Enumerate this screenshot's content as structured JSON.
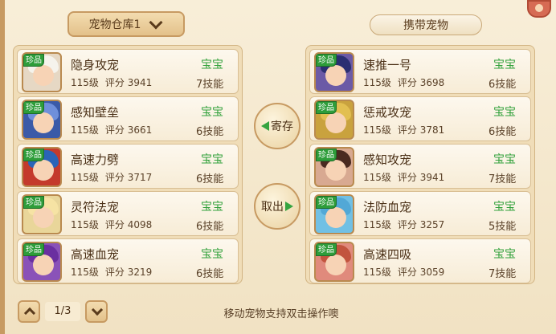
{
  "left_header": {
    "label": "宠物仓库1"
  },
  "right_header": {
    "label": "携带宠物"
  },
  "buttons": {
    "store": "寄存",
    "take": "取出"
  },
  "level_label": "级",
  "score_label": "评分",
  "skills_suffix": "技能",
  "storage_pets": [
    {
      "tag": "珍品",
      "name": "隐身攻宠",
      "level": "115",
      "score": "3941",
      "type": "宝宝",
      "skills": "7",
      "palette": {
        "bg": "#e6d8c4",
        "hair": "#f5f3ec"
      }
    },
    {
      "tag": "珍品",
      "name": "感知壁垒",
      "level": "115",
      "score": "3661",
      "type": "宝宝",
      "skills": "6",
      "palette": {
        "bg": "#3b5aa8",
        "hair": "#6f8fdb"
      }
    },
    {
      "tag": "珍品",
      "name": "高速力劈",
      "level": "115",
      "score": "3717",
      "type": "宝宝",
      "skills": "6",
      "palette": {
        "bg": "#c43a2c",
        "hair": "#2a64b8"
      }
    },
    {
      "tag": "珍品",
      "name": "灵符法宠",
      "level": "115",
      "score": "4098",
      "type": "宝宝",
      "skills": "6",
      "palette": {
        "bg": "#e9d69a",
        "hair": "#f6e3a4"
      }
    },
    {
      "tag": "珍品",
      "name": "高速血宠",
      "level": "115",
      "score": "3219",
      "type": "宝宝",
      "skills": "6",
      "palette": {
        "bg": "#8a52b8",
        "hair": "#6a2fa0"
      }
    }
  ],
  "carried_pets": [
    {
      "tag": "珍品",
      "name": "速推一号",
      "level": "115",
      "score": "3698",
      "type": "宝宝",
      "skills": "6",
      "palette": {
        "bg": "#6b5aa6",
        "hair": "#2b2f72"
      }
    },
    {
      "tag": "珍品",
      "name": "惩戒攻宠",
      "level": "115",
      "score": "3781",
      "type": "宝宝",
      "skills": "6",
      "palette": {
        "bg": "#c9a23e",
        "hair": "#e2bf51"
      }
    },
    {
      "tag": "珍品",
      "name": "感知攻宠",
      "level": "115",
      "score": "3941",
      "type": "宝宝",
      "skills": "7",
      "palette": {
        "bg": "#d8a991",
        "hair": "#4a2a20"
      }
    },
    {
      "tag": "珍品",
      "name": "法防血宠",
      "level": "115",
      "score": "3257",
      "type": "宝宝",
      "skills": "5",
      "palette": {
        "bg": "#71c0e4",
        "hair": "#52a8d6"
      }
    },
    {
      "tag": "珍品",
      "name": "高速四吸",
      "level": "115",
      "score": "3059",
      "type": "宝宝",
      "skills": "7",
      "palette": {
        "bg": "#e08a7c",
        "hair": "#c2543e"
      }
    }
  ],
  "pager": {
    "current": "1/3"
  },
  "footer_hint": "移动宠物支持双击操作噢"
}
